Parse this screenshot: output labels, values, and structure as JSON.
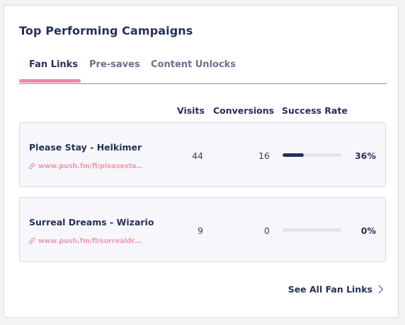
{
  "card": {
    "title": "Top Performing Campaigns"
  },
  "tabs": [
    {
      "label": "Fan Links",
      "active": true
    },
    {
      "label": "Pre-saves",
      "active": false
    },
    {
      "label": "Content Unlocks",
      "active": false
    }
  ],
  "columns": {
    "visits": "Visits",
    "conversions": "Conversions",
    "success_rate": "Success Rate"
  },
  "rows": [
    {
      "name": "Please Stay - Helkimer",
      "link": "www.push.fm/fl/pleasestayh…",
      "visits": "44",
      "conversions": "16",
      "success_rate": "36%",
      "success_fraction": 0.36
    },
    {
      "name": "Surreal Dreams - Wizario",
      "link": "www.push.fm/fl/surrealdreams",
      "visits": "9",
      "conversions": "0",
      "success_rate": "0%",
      "success_fraction": 0
    }
  ],
  "footer": {
    "see_all_label": "See All Fan Links"
  },
  "colors": {
    "primary": "#25305a",
    "accent_pink": "#ee8aa2",
    "link_pink": "#f09aae",
    "bar_track": "#e3e5ec"
  },
  "icons": {
    "link": "link-icon",
    "chevron": "chevron-right-icon"
  }
}
